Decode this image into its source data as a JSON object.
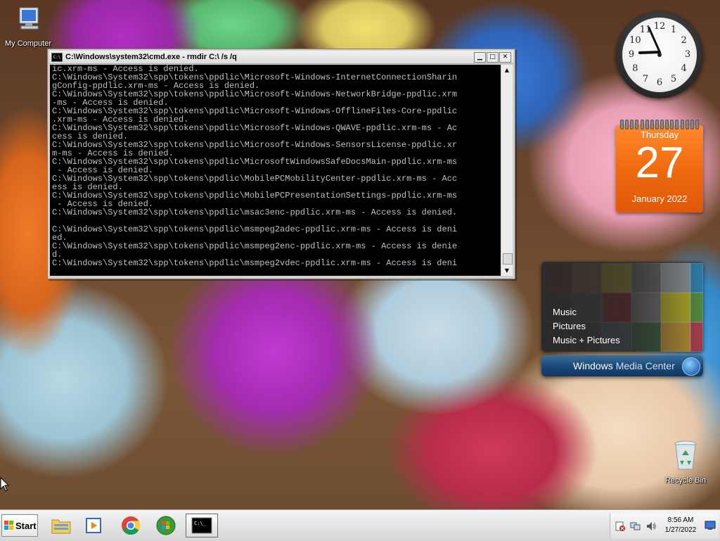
{
  "desktop": {
    "my_computer_label": "My Computer",
    "recycle_bin_label": "Recycle Bin"
  },
  "cmd_window": {
    "title": "C:\\Windows\\system32\\cmd.exe - rmdir  C:\\ /s /q",
    "lines": [
      "ic.xrm-ms - Access is denied.",
      "C:\\Windows\\System32\\spp\\tokens\\ppdlic\\Microsoft-Windows-InternetConnectionSharin",
      "gConfig-ppdlic.xrm-ms - Access is denied.",
      "C:\\Windows\\System32\\spp\\tokens\\ppdlic\\Microsoft-Windows-NetworkBridge-ppdlic.xrm",
      "-ms - Access is denied.",
      "C:\\Windows\\System32\\spp\\tokens\\ppdlic\\Microsoft-Windows-OfflineFiles-Core-ppdlic",
      ".xrm-ms - Access is denied.",
      "C:\\Windows\\System32\\spp\\tokens\\ppdlic\\Microsoft-Windows-QWAVE-ppdlic.xrm-ms - Ac",
      "cess is denied.",
      "C:\\Windows\\System32\\spp\\tokens\\ppdlic\\Microsoft-Windows-SensorsLicense-ppdlic.xr",
      "m-ms - Access is denied.",
      "C:\\Windows\\System32\\spp\\tokens\\ppdlic\\MicrosoftWindowsSafeDocsMain-ppdlic.xrm-ms",
      " - Access is denied.",
      "C:\\Windows\\System32\\spp\\tokens\\ppdlic\\MobilePCMobilityCenter-ppdlic.xrm-ms - Acc",
      "ess is denied.",
      "C:\\Windows\\System32\\spp\\tokens\\ppdlic\\MobilePCPresentationSettings-ppdlic.xrm-ms",
      " - Access is denied.",
      "C:\\Windows\\System32\\spp\\tokens\\ppdlic\\msac3enc-ppdlic.xrm-ms - Access is denied.",
      "",
      "C:\\Windows\\System32\\spp\\tokens\\ppdlic\\msmpeg2adec-ppdlic.xrm-ms - Access is deni",
      "ed.",
      "C:\\Windows\\System32\\spp\\tokens\\ppdlic\\msmpeg2enc-ppdlic.xrm-ms - Access is denie",
      "d.",
      "C:\\Windows\\System32\\spp\\tokens\\ppdlic\\msmpeg2vdec-ppdlic.xrm-ms - Access is deni"
    ]
  },
  "clock_gadget": {
    "numbers": [
      "12",
      "1",
      "2",
      "3",
      "4",
      "5",
      "6",
      "7",
      "8",
      "9",
      "10",
      "11"
    ],
    "time": "8:56"
  },
  "calendar_gadget": {
    "weekday": "Thursday",
    "day": "27",
    "month_year": "January 2022"
  },
  "media_center_gadget": {
    "menu": [
      "Music",
      "Pictures",
      "Music + Pictures"
    ],
    "brand_bold": "Windows",
    "brand_light": "Media Center"
  },
  "taskbar": {
    "start_label": "Start",
    "time": "8:56 AM",
    "date": "1/27/2022"
  },
  "colors": {
    "calendar_orange": "#f06a10",
    "console_bg": "#000000",
    "console_text": "#c0c0c0"
  }
}
